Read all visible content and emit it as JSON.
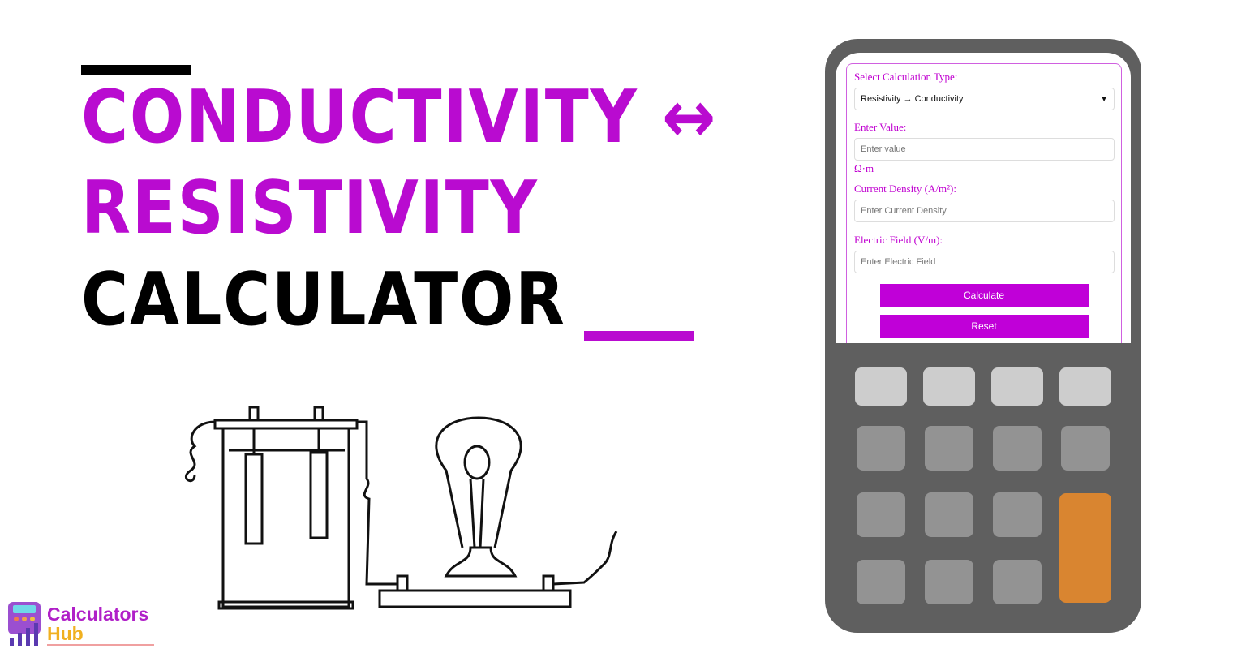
{
  "title": {
    "line1": "CONDUCTIVITY ↔",
    "line2": "RESISTIVITY",
    "line3": "CALCULATOR"
  },
  "colors": {
    "accent": "#b90bd0",
    "calc_body": "#5f5f5f",
    "key_light": "#cdcdcd",
    "key_mid": "#939393",
    "key_orange": "#d98530"
  },
  "form": {
    "type_label": "Select Calculation Type:",
    "type_value": "Resistivity → Conductivity",
    "value_label": "Enter Value:",
    "value_placeholder": "Enter value",
    "unit": "Ω·m",
    "density_label": "Current Density (A/m²):",
    "density_placeholder": "Enter Current Density",
    "field_label": "Electric Field (V/m):",
    "field_placeholder": "Enter Electric Field",
    "calculate": "Calculate",
    "reset": "Reset"
  },
  "logo": {
    "line1": "Calculators",
    "line2": "Hub"
  }
}
